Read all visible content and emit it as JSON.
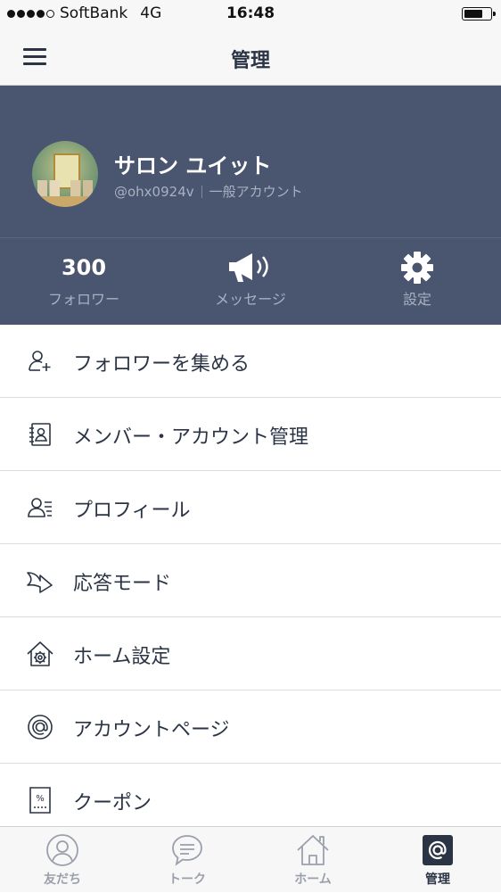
{
  "status_bar": {
    "carrier": "SoftBank",
    "network": "4G",
    "time": "16:48"
  },
  "nav": {
    "title": "管理"
  },
  "profile": {
    "name": "サロン ユイット",
    "account_id": "@ohx0924v",
    "account_type": "一般アカウント"
  },
  "stats": {
    "followers_value": "300",
    "followers_label": "フォロワー",
    "message_label": "メッセージ",
    "settings_label": "設定"
  },
  "menu": {
    "items": [
      {
        "label": "フォロワーを集める",
        "icon": "add-person-icon"
      },
      {
        "label": "メンバー・アカウント管理",
        "icon": "address-book-icon"
      },
      {
        "label": "プロフィール",
        "icon": "profile-card-icon"
      },
      {
        "label": "応答モード",
        "icon": "reply-arrow-icon"
      },
      {
        "label": "ホーム設定",
        "icon": "home-gear-icon"
      },
      {
        "label": "アカウントページ",
        "icon": "at-sign-icon"
      },
      {
        "label": "クーポン",
        "icon": "coupon-icon"
      }
    ]
  },
  "tabs": [
    {
      "label": "友だち",
      "icon": "friends-icon"
    },
    {
      "label": "トーク",
      "icon": "chat-bubble-icon"
    },
    {
      "label": "ホーム",
      "icon": "home-icon"
    },
    {
      "label": "管理",
      "icon": "at-sign-icon",
      "active": true
    }
  ],
  "colors": {
    "header_bg": "#4a5570",
    "text_dark": "#2b3445",
    "text_muted": "#a8b0c2"
  }
}
